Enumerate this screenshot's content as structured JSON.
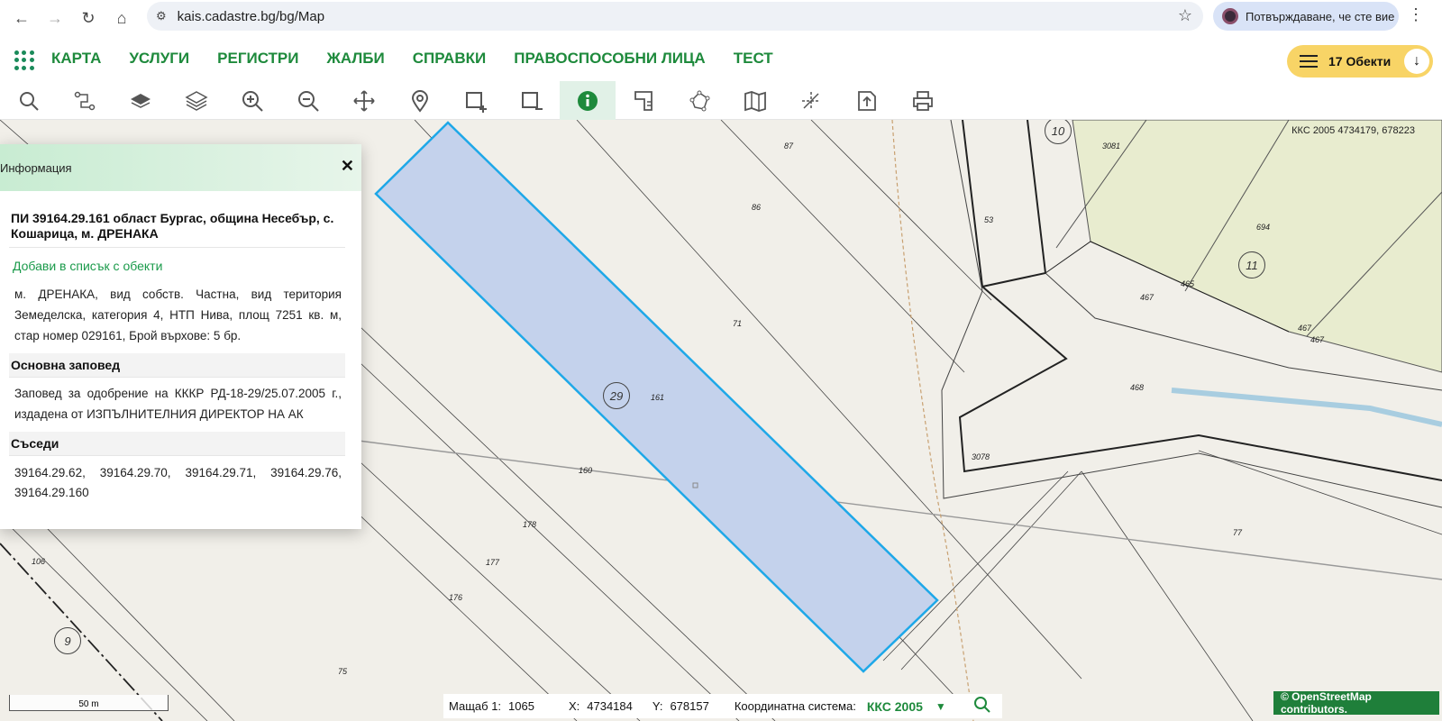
{
  "browser": {
    "url": "kais.cadastre.bg/bg/Map",
    "verify_label": "Потвърждаване, че сте вие"
  },
  "nav": {
    "items": [
      "КАРТА",
      "УСЛУГИ",
      "РЕГИСТРИ",
      "ЖАЛБИ",
      "СПРАВКИ",
      "ПРАВОСПОСОБНИ ЛИЦА",
      "ТЕСТ"
    ],
    "objects_label": "17 Обекти"
  },
  "toolbar": {
    "tools": [
      "search-icon",
      "route-icon",
      "layers-icon",
      "layers-stack-icon",
      "zoom-in-icon",
      "zoom-out-icon",
      "pan-icon",
      "pin-icon",
      "select-add-icon",
      "select-remove-icon",
      "info-icon",
      "measure-icon",
      "polygon-icon",
      "map-icon",
      "cut-icon",
      "export-icon",
      "print-icon"
    ],
    "active_tool": "info-icon"
  },
  "map": {
    "coords_label": "ККС 2005 4734179, 678223",
    "labels": [
      "87",
      "86",
      "71",
      "161",
      "160",
      "178",
      "177",
      "176",
      "75",
      "106",
      "53",
      "694",
      "467",
      "465",
      "468",
      "3078",
      "3081",
      "77"
    ],
    "circle_labels": [
      "10",
      "11",
      "29",
      "9"
    ],
    "extra_labels": [
      "467",
      "467"
    ]
  },
  "info_panel": {
    "title": "Информация",
    "parcel": "ПИ 39164.29.161 област Бургас, община Несебър, с. Кошарица, м. ДРЕНАКА",
    "add_link": "Добави в списък с обекти",
    "description": "м. ДРЕНАКА, вид собств. Частна, вид територия Земеделска, категория 4, НТП Нива, площ 7251 кв. м, стар номер 029161, Брой върхове: 5 бр.",
    "order_heading": "Основна заповед",
    "order_text": "Заповед за одобрение на КККР РД-18-29/25.07.2005 г., издадена от ИЗПЪЛНИТЕЛНИЯ ДИРЕКТОР НА АК",
    "neighbors_heading": "Съседи",
    "neighbors": "39164.29.62, 39164.29.70, 39164.29.71, 39164.29.76, 39164.29.160"
  },
  "status": {
    "scale_label": "Мащаб 1:",
    "scale_value": "1065",
    "x_label": "X:",
    "x_value": "4734184",
    "y_label": "Y:",
    "y_value": "678157",
    "crs_label": "Координатна система:",
    "crs_value": "ККС 2005",
    "scalebar": "50 m",
    "attribution": "© OpenStreetMap contributors."
  }
}
